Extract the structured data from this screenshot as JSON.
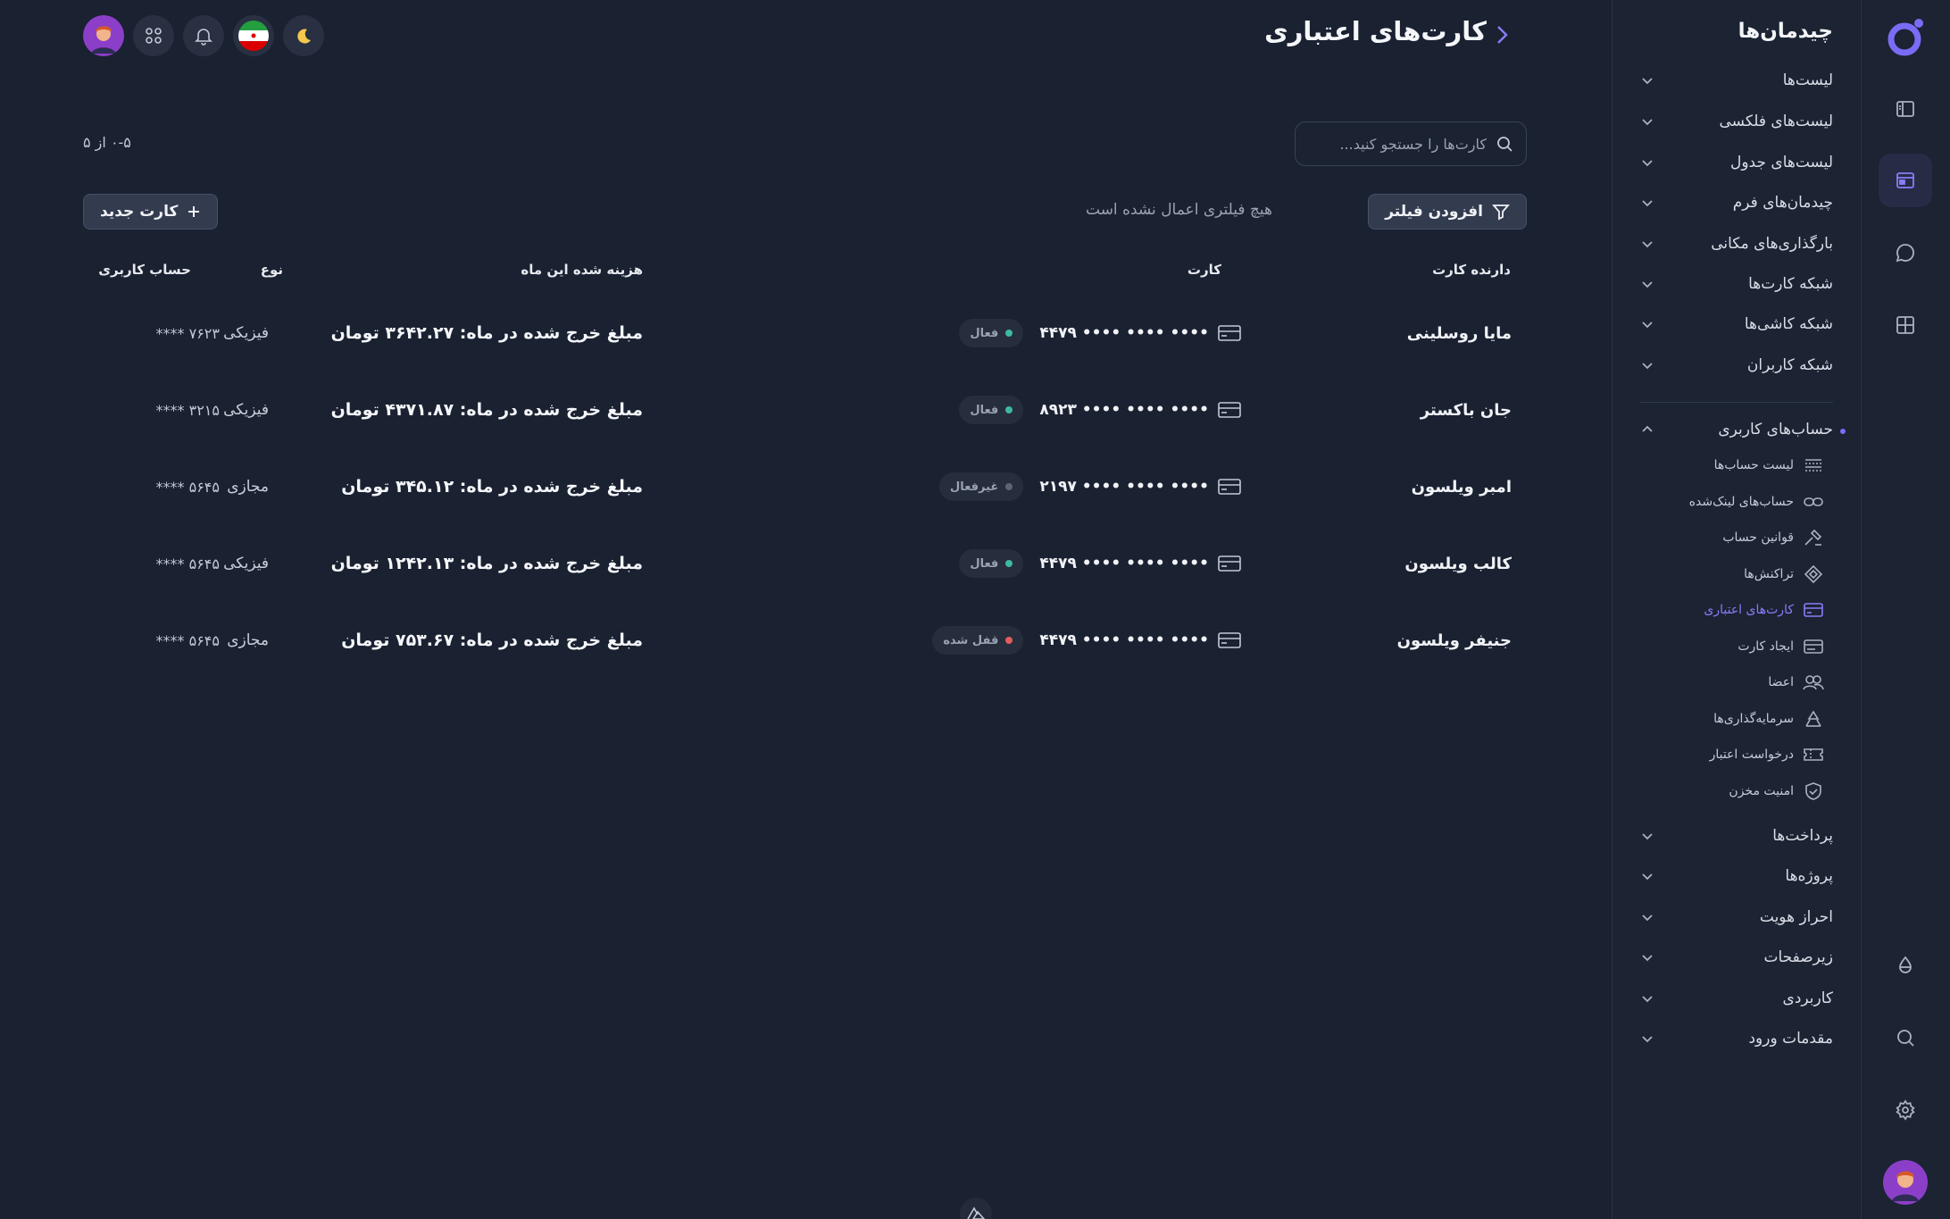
{
  "header": {
    "title": "کارت‌های اعتباری",
    "search_placeholder": "کارت‌ها را جستجو کنید...",
    "pagination": "۰-۵ از ۵"
  },
  "toolbar": {
    "filter_label": "افزودن فیلتر",
    "no_filter_text": "هیچ فیلتری اعمال نشده است",
    "new_card_label": "کارت جدید"
  },
  "table": {
    "headers": {
      "holder": "دارنده کارت",
      "card": "کارت",
      "spent": "هزینه شده این ماه",
      "type": "نوع",
      "account": "حساب کاربری"
    },
    "rows": [
      {
        "holder": "مایا روسلینی",
        "card": "•••• •••• •••• ۴۴۷۹",
        "status": "فعال",
        "status_color": "#3fb8a0",
        "spent": "مبلغ خرج شده در ماه: ۳۶۴۲.۲۷ تومان",
        "type": "فیزیکی",
        "account": "**** ۷۶۲۳"
      },
      {
        "holder": "جان باکستر",
        "card": "•••• •••• •••• ۸۹۲۳",
        "status": "فعال",
        "status_color": "#3fb8a0",
        "spent": "مبلغ خرج شده در ماه: ۴۳۷۱.۸۷ تومان",
        "type": "فیزیکی",
        "account": "**** ۳۲۱۵"
      },
      {
        "holder": "امبر ویلسون",
        "card": "•••• •••• •••• ۲۱۹۷",
        "status": "غیرفعال",
        "status_color": "#5d6475",
        "spent": "مبلغ خرج شده در ماه: ۳۴۵.۱۲ تومان",
        "type": "مجازی",
        "account": "**** ۵۶۴۵"
      },
      {
        "holder": "کالب ویلسون",
        "card": "•••• •••• •••• ۴۴۷۹",
        "status": "فعال",
        "status_color": "#3fb8a0",
        "spent": "مبلغ خرج شده در ماه: ۱۲۴۲.۱۳ تومان",
        "type": "فیزیکی",
        "account": "**** ۵۶۴۵"
      },
      {
        "holder": "جنیفر ویلسون",
        "card": "•••• •••• •••• ۴۴۷۹",
        "status": "قفل شده",
        "status_color": "#e25c5c",
        "spent": "مبلغ خرج شده در ماه: ۷۵۳.۶۷ تومان",
        "type": "مجازی",
        "account": "**** ۵۶۴۵"
      }
    ]
  },
  "sidebar": {
    "title": "چیدمان‌ها",
    "items": [
      {
        "label": "لیست‌ها"
      },
      {
        "label": "لیست‌های فلکسی"
      },
      {
        "label": "لیست‌های جدول"
      },
      {
        "label": "چیدمان‌های فرم"
      },
      {
        "label": "بارگذاری‌های مکانی"
      },
      {
        "label": "شبکه کارت‌ها"
      },
      {
        "label": "شبکه کاشی‌ها"
      },
      {
        "label": "شبکه کاربران"
      }
    ],
    "open_group": "حساب‌های کاربری",
    "sub_items": [
      {
        "label": "لیست حساب‌ها",
        "icon": "list-lines-icon"
      },
      {
        "label": "حساب‌های لینک‌شده",
        "icon": "link-icon"
      },
      {
        "label": "قوانین حساب",
        "icon": "gavel-icon"
      },
      {
        "label": "تراکنش‌ها",
        "icon": "transactions-icon"
      },
      {
        "label": "کارت‌های اعتباری",
        "icon": "credit-card-icon"
      },
      {
        "label": "ایجاد کارت",
        "icon": "card-plus-icon"
      },
      {
        "label": "اعضا",
        "icon": "users-icon"
      },
      {
        "label": "سرمایه‌گذاری‌ها",
        "icon": "recycle-icon"
      },
      {
        "label": "درخواست اعتبار",
        "icon": "ticket-icon"
      },
      {
        "label": "امنیت مخزن",
        "icon": "shield-icon"
      }
    ],
    "bottom_items": [
      {
        "label": "پرداخت‌ها"
      },
      {
        "label": "پروژه‌ها"
      },
      {
        "label": "احراز هویت"
      },
      {
        "label": "زیرصفحات"
      },
      {
        "label": "کاربردی"
      },
      {
        "label": "مقدمات ورود"
      }
    ]
  },
  "colors": {
    "background": "#1a2131",
    "panel": "#1c2333",
    "accent": "#7b6cf6",
    "active_status": "#3fb8a0",
    "locked_status": "#e25c5c"
  }
}
